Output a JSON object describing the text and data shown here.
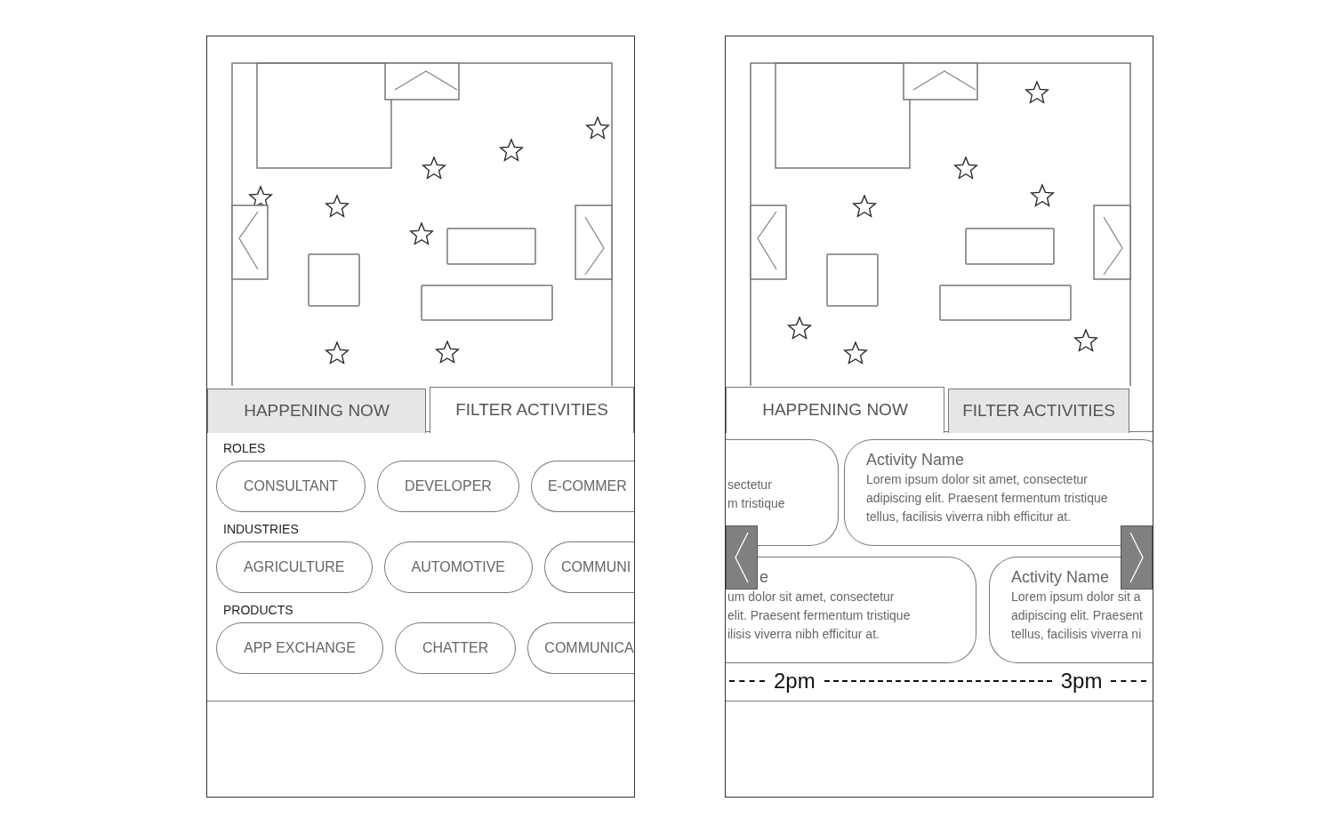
{
  "screens": [
    {
      "tabs": [
        {
          "label": "HAPPENING NOW",
          "selected": false
        },
        {
          "label": "FILTER ACTIVITIES",
          "selected": true
        }
      ],
      "filters": [
        {
          "heading": "ROLES",
          "options": [
            "CONSULTANT",
            "DEVELOPER",
            "E-COMMER"
          ]
        },
        {
          "heading": "INDUSTRIES",
          "options": [
            "AGRICULTURE",
            "AUTOMOTIVE",
            "COMMUNI"
          ]
        },
        {
          "heading": "PRODUCTS",
          "options": [
            "APP EXCHANGE",
            "CHATTER",
            "COMMUNICA"
          ]
        }
      ]
    },
    {
      "tabs": [
        {
          "label": "HAPPENING NOW",
          "selected": true
        },
        {
          "label": "FILTER ACTIVITIES",
          "selected": false
        }
      ],
      "activity_rows": [
        [
          {
            "kind": "cut-left",
            "lines": [
              "sectetur",
              "m tristique"
            ]
          },
          {
            "kind": "full",
            "title": "Activity Name",
            "lines": [
              "Lorem ipsum dolor sit amet, consectetur",
              "adipiscing elit. Praesent fermentum tristique",
              "tellus, facilisis viverra nibh efficitur at."
            ]
          }
        ],
        [
          {
            "kind": "cut-left",
            "title": "e",
            "lines": [
              "um dolor sit amet, consectetur",
              "elit. Praesent fermentum tristique",
              "ilisis viverra nibh efficitur at."
            ]
          },
          {
            "kind": "cut-right",
            "title": "Activity Name",
            "lines": [
              "Lorem ipsum dolor sit a",
              "adipiscing elit. Praesent",
              "tellus, facilisis viverra ni"
            ]
          }
        ]
      ],
      "timeline": [
        "2pm",
        "3pm"
      ]
    }
  ]
}
